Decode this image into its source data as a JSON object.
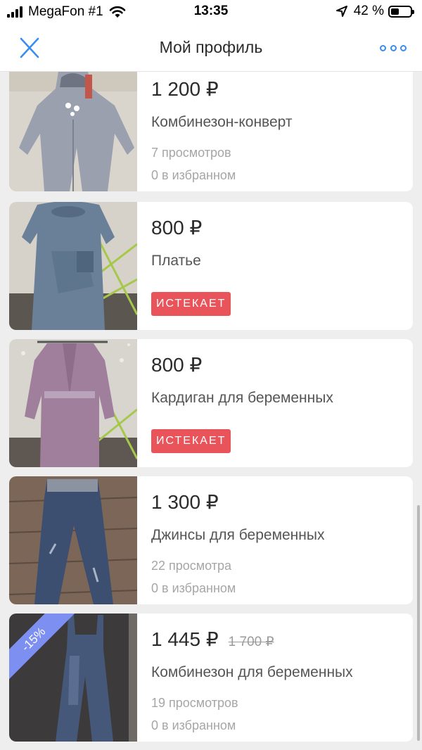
{
  "status": {
    "carrier": "MegaFon #1",
    "time": "13:35",
    "battery": "42 %",
    "battery_level": 0.42
  },
  "nav": {
    "title": "Мой профиль"
  },
  "items": [
    {
      "price": "1 200 ₽",
      "title": "Комбинезон-конверт",
      "views": "7 просмотров",
      "favs": "0 в избранном"
    },
    {
      "price": "800 ₽",
      "title": "Платье",
      "badge": "ИСТЕКАЕТ"
    },
    {
      "price": "800 ₽",
      "title": "Кардиган для беременных",
      "badge": "ИСТЕКАЕТ"
    },
    {
      "price": "1 300 ₽",
      "title": "Джинсы для беременных",
      "views": "22 просмотра",
      "favs": "0 в избранном"
    },
    {
      "price": "1 445 ₽",
      "old_price": "1 700 ₽",
      "discount": "-15%",
      "title": "Комбинезон для беременных",
      "views": "19 просмотров",
      "favs": "0 в избранном"
    }
  ],
  "colors": {
    "accent": "#3a8df0",
    "badge": "#e9545a",
    "discount": "#7d8ff0"
  }
}
